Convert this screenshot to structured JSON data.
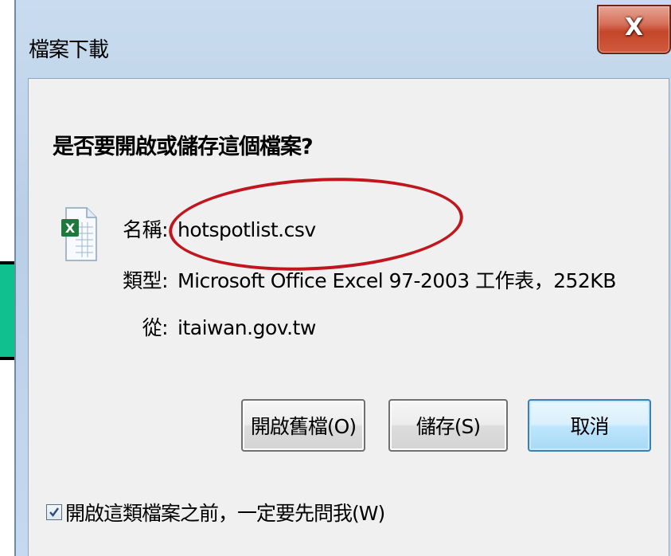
{
  "window": {
    "title": "檔案下載",
    "close_label": "X"
  },
  "dialog": {
    "question": "是否要開啟或儲存這個檔案?",
    "file": {
      "icon": "excel-file-icon",
      "name_label": "名稱:",
      "name_value": "hotspotlist.csv",
      "type_label": "類型:",
      "type_value": "Microsoft Office Excel 97-2003 工作表，252KB",
      "from_label": "從:",
      "from_value": "itaiwan.gov.tw"
    },
    "buttons": {
      "open": "開啟舊檔(O)",
      "save": "儲存(S)",
      "cancel": "取消"
    },
    "checkbox": {
      "label": "開啟這類檔案之前，一定要先問我(W)",
      "checked": true
    }
  },
  "annotations": {
    "highlight_color": "#c0161d",
    "arrow_color": "#11c08f"
  }
}
